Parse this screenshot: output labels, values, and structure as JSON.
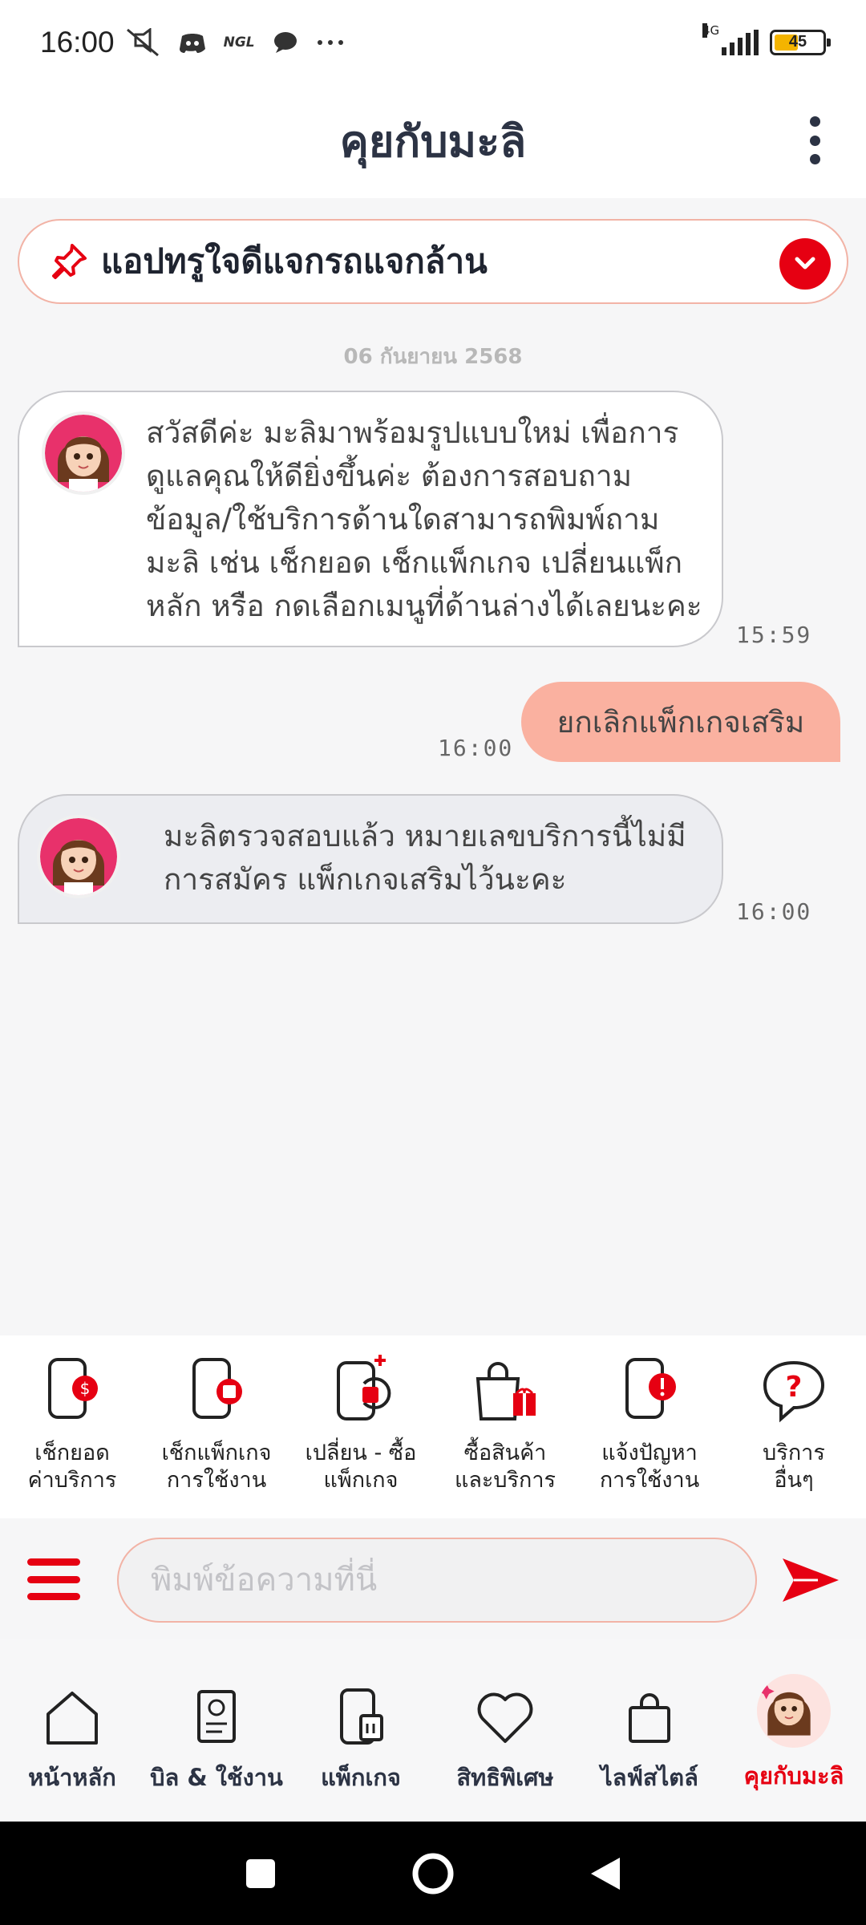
{
  "status_bar": {
    "time": "16:00",
    "icons": [
      "mute-icon",
      "discord-icon",
      "ngl-icon",
      "chat-icon",
      "more-icon"
    ],
    "ngl_label": "NGL",
    "network": "4G",
    "battery": "45"
  },
  "header": {
    "title": "คุยกับมะลิ"
  },
  "pinned": {
    "label": "แอปทรูใจดีแจกรถแจกล้าน"
  },
  "chat": {
    "date": "06 กันยายน 2568",
    "messages": [
      {
        "from": "bot",
        "text": "สวัสดีค่ะ มะลิมาพร้อมรูปแบบใหม่ เพื่อการ\nดูแลคุณให้ดียิ่งขึ้นค่ะ ต้องการสอบถาม\nข้อมูล/ใช้บริการด้านใดสามารถพิมพ์ถาม\nมะลิ เช่น เช็กยอด เช็กแพ็กเกจ เปลี่ยนแพ็ก\nหลัก หรือ กดเลือกเมนูที่ด้านล่างได้เลยนะคะ",
        "time": "15:59"
      },
      {
        "from": "user",
        "text": "ยกเลิกแพ็กเกจเสริม",
        "time": "16:00"
      },
      {
        "from": "bot",
        "text": "มะลิตรวจสอบแล้ว หมายเลขบริการนี้ไม่มี\nการสมัคร แพ็กเกจเสริมไว้นะคะ",
        "time": "16:00"
      }
    ]
  },
  "quick_actions": [
    {
      "icon": "phone-bill-icon",
      "label": "เช็กยอด\nค่าบริการ"
    },
    {
      "icon": "phone-package-icon",
      "label": "เช็กแพ็กเกจ\nการใช้งาน"
    },
    {
      "icon": "phone-change-icon",
      "label": "เปลี่ยน - ซื้อ\nแพ็กเกจ"
    },
    {
      "icon": "shopping-bag-icon",
      "label": "ซื้อสินค้า\nและบริการ"
    },
    {
      "icon": "phone-alert-icon",
      "label": "แจ้งปัญหา\nการใช้งาน"
    },
    {
      "icon": "help-bubble-icon",
      "label": "บริการ\nอื่นๆ"
    }
  ],
  "input": {
    "placeholder": "พิมพ์ข้อความที่นี่"
  },
  "bottom_nav": [
    {
      "icon": "home-icon",
      "label": "หน้าหลัก"
    },
    {
      "icon": "bill-icon",
      "label": "บิล & ใช้งาน"
    },
    {
      "icon": "package-icon",
      "label": "แพ็กเกจ"
    },
    {
      "icon": "heart-icon",
      "label": "สิทธิพิเศษ"
    },
    {
      "icon": "bag-icon",
      "label": "ไลฟ์สไตล์"
    },
    {
      "icon": "mali-avatar",
      "label": "คุยกับมะลิ",
      "active": true
    }
  ],
  "colors": {
    "accent": "#e60012",
    "user_bubble": "#fab1a0",
    "pin_border": "#f2b3a6"
  }
}
